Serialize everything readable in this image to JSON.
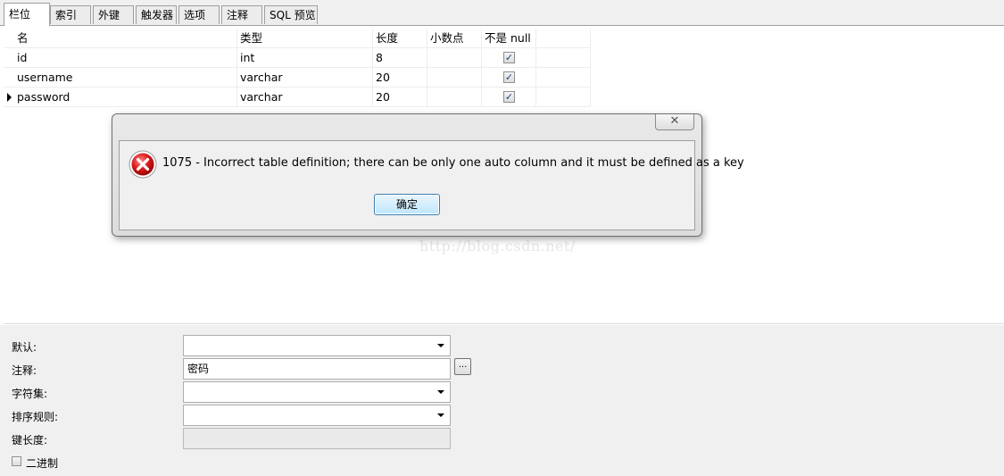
{
  "tabs": [
    {
      "label": "栏位"
    },
    {
      "label": "索引"
    },
    {
      "label": "外键"
    },
    {
      "label": "触发器"
    },
    {
      "label": "选项"
    },
    {
      "label": "注释"
    },
    {
      "label": "SQL 预览"
    }
  ],
  "grid": {
    "columns": [
      "名",
      "类型",
      "长度",
      "小数点",
      "不是 null"
    ],
    "rows": [
      {
        "name": "id",
        "type": "int",
        "length": "8",
        "decimals": "",
        "not_null": true
      },
      {
        "name": "username",
        "type": "varchar",
        "length": "20",
        "decimals": "",
        "not_null": true
      },
      {
        "name": "password",
        "type": "varchar",
        "length": "20",
        "decimals": "",
        "not_null": true
      }
    ]
  },
  "dialog": {
    "message": "1075 - Incorrect table definition; there can be only one auto column and it must be defined as a key",
    "ok_label": "确定",
    "close_symbol": "✕"
  },
  "watermark": "http://blog.csdn.net/",
  "properties": {
    "default_label": "默认:",
    "default_value": "",
    "comment_label": "注释:",
    "comment_value": "密码",
    "ellipsis_label": "...",
    "charset_label": "字符集:",
    "charset_value": "",
    "collation_label": "排序规则:",
    "collation_value": "",
    "key_length_label": "键长度:",
    "key_length_value": "",
    "binary_label": "二进制",
    "binary_checked": false
  }
}
